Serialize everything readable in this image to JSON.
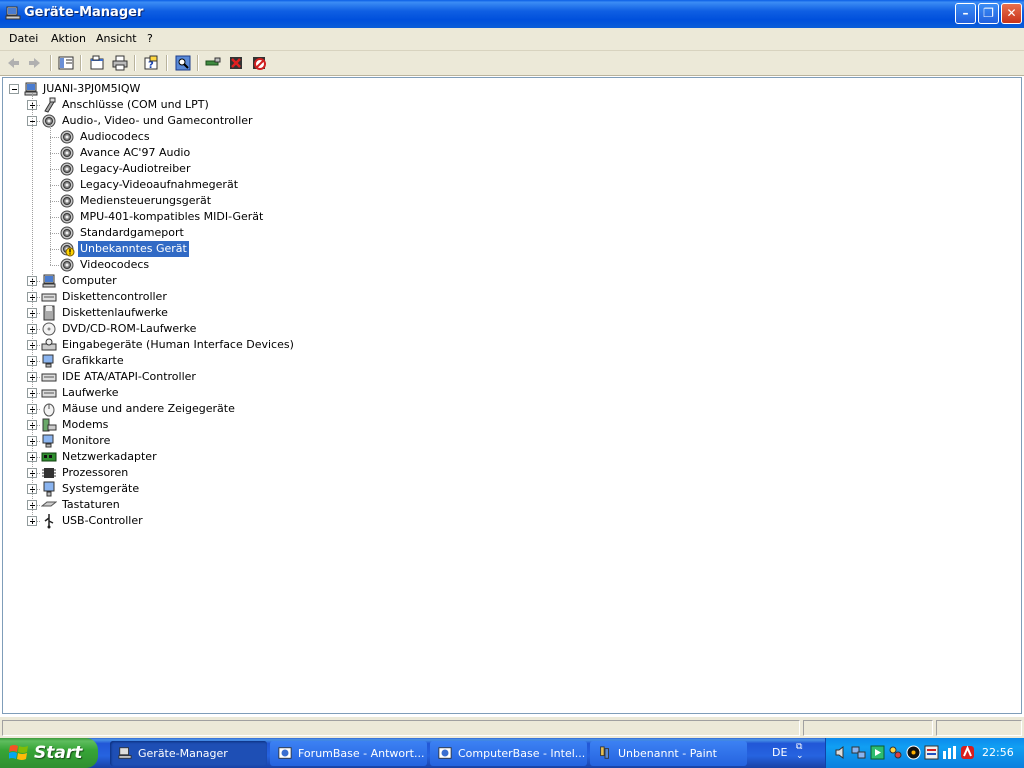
{
  "window": {
    "title": "Geräte-Manager"
  },
  "menu": [
    "Datei",
    "Aktion",
    "Ansicht",
    "?"
  ],
  "toolbar": {
    "icons": [
      "back-arrow-icon",
      "forward-arrow-icon",
      "console-tree-icon",
      "properties-icon",
      "print-icon",
      "help-icon",
      "scan-hardware-icon",
      "update-driver-icon",
      "uninstall-icon",
      "disable-icon"
    ]
  },
  "tree": {
    "root": "JUANI-3PJ0M5IQW",
    "categories": [
      {
        "label": "Anschlüsse (COM und LPT)",
        "expanded": false
      },
      {
        "label": "Audio-, Video- und Gamecontroller",
        "expanded": true,
        "children": [
          "Audiocodecs",
          "Avance AC'97 Audio",
          "Legacy-Audiotreiber",
          "Legacy-Videoaufnahmegerät",
          "Mediensteuerungsgerät",
          "MPU-401-kompatibles MIDI-Gerät",
          "Standardgameport",
          "Unbekanntes Gerät",
          "Videocodecs"
        ],
        "selected_child": "Unbekanntes Gerät"
      },
      {
        "label": "Computer",
        "expanded": false
      },
      {
        "label": "Diskettencontroller",
        "expanded": false
      },
      {
        "label": "Diskettenlaufwerke",
        "expanded": false
      },
      {
        "label": "DVD/CD-ROM-Laufwerke",
        "expanded": false
      },
      {
        "label": "Eingabegeräte (Human Interface Devices)",
        "expanded": false
      },
      {
        "label": "Grafikkarte",
        "expanded": false
      },
      {
        "label": "IDE ATA/ATAPI-Controller",
        "expanded": false
      },
      {
        "label": "Laufwerke",
        "expanded": false
      },
      {
        "label": "Mäuse und andere Zeigegeräte",
        "expanded": false
      },
      {
        "label": "Modems",
        "expanded": false
      },
      {
        "label": "Monitore",
        "expanded": false
      },
      {
        "label": "Netzwerkadapter",
        "expanded": false
      },
      {
        "label": "Prozessoren",
        "expanded": false
      },
      {
        "label": "Systemgeräte",
        "expanded": false
      },
      {
        "label": "Tastaturen",
        "expanded": false
      },
      {
        "label": "USB-Controller",
        "expanded": false
      }
    ]
  },
  "taskbar": {
    "start": "Start",
    "tasks": [
      {
        "label": "Geräte-Manager",
        "active": true
      },
      {
        "label": "ForumBase - Antwort...",
        "active": false
      },
      {
        "label": "ComputerBase - Intel...",
        "active": false
      },
      {
        "label": "Unbenannt - Paint",
        "active": false
      }
    ],
    "language": "DE",
    "clock": "22:56"
  },
  "colors": {
    "selection": "#316ac5",
    "titlebar": "#0054e3",
    "taskbar": "#245edb",
    "start": "#3c9a3c"
  }
}
